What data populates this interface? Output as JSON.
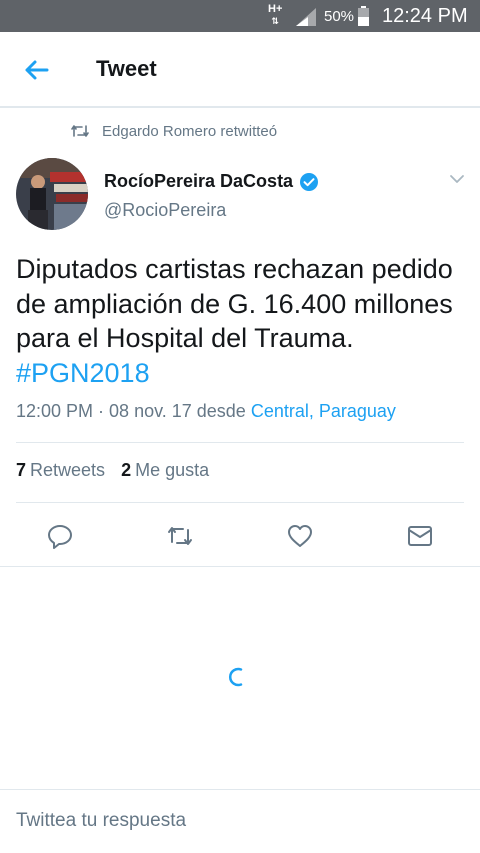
{
  "status_bar": {
    "network_type": "H+",
    "battery_percent": "50%",
    "time": "12:24 PM"
  },
  "header": {
    "title": "Tweet"
  },
  "retweet_context": {
    "text": "Edgardo Romero retwitteó"
  },
  "author": {
    "name": "RocíoPereira DaCosta",
    "handle": "@RocioPereira",
    "verified": true
  },
  "tweet": {
    "text": "Diputados cartistas rechazan pedido de ampliación de G. 16.400 millones para el Hospital del Trauma. ",
    "hashtag": "#PGN2018",
    "timestamp": "12:00 PM · 08 nov. 17 desde ",
    "location": "Central, Paraguay"
  },
  "stats": {
    "retweets_count": "7",
    "retweets_label": "Retweets",
    "likes_count": "2",
    "likes_label": "Me gusta"
  },
  "reply": {
    "placeholder": "Twittea tu respuesta"
  },
  "colors": {
    "accent": "#1da1f2",
    "text_primary": "#14171a",
    "text_secondary": "#657786",
    "divider": "#e1e8ed",
    "status_bar": "#5f6368"
  }
}
